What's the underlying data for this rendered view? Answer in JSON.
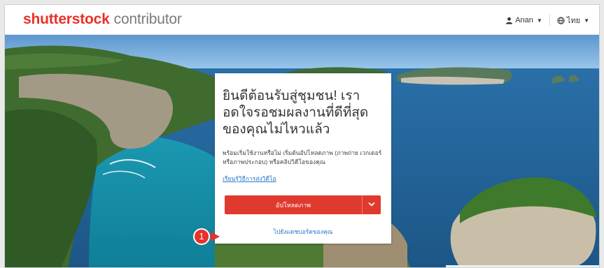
{
  "header": {
    "brand": "shutterstock",
    "product": "contributor",
    "user_label": "Anan",
    "language_label": "ไทย"
  },
  "card": {
    "headline": "ยินดีต้อนรับสู่ชุมชน! เราอดใจรอชมผลงานที่ดีที่สุดของคุณไม่ไหวแล้ว",
    "description": "พร้อมเริ่มใช้งานหรือไม่ เริ่มต้นอัปโหลดภาพ (ภาพถ่าย เวกเตอร์ หรือภาพประกอบ) หรือคลิปวิดีโอของคุณ",
    "video_link": "เรียนรู้วิธีการส่งวิดีโอ",
    "upload_button": "อัปโหลดภาพ",
    "dashboard_link": "ไปยังแดชบอร์ดของคุณ"
  },
  "annotation": {
    "step_number": "1"
  },
  "colors": {
    "brand_red": "#e8312a",
    "link_blue": "#2a75c9"
  },
  "icons": [
    "user-icon",
    "chevron-down-icon",
    "globe-icon"
  ]
}
